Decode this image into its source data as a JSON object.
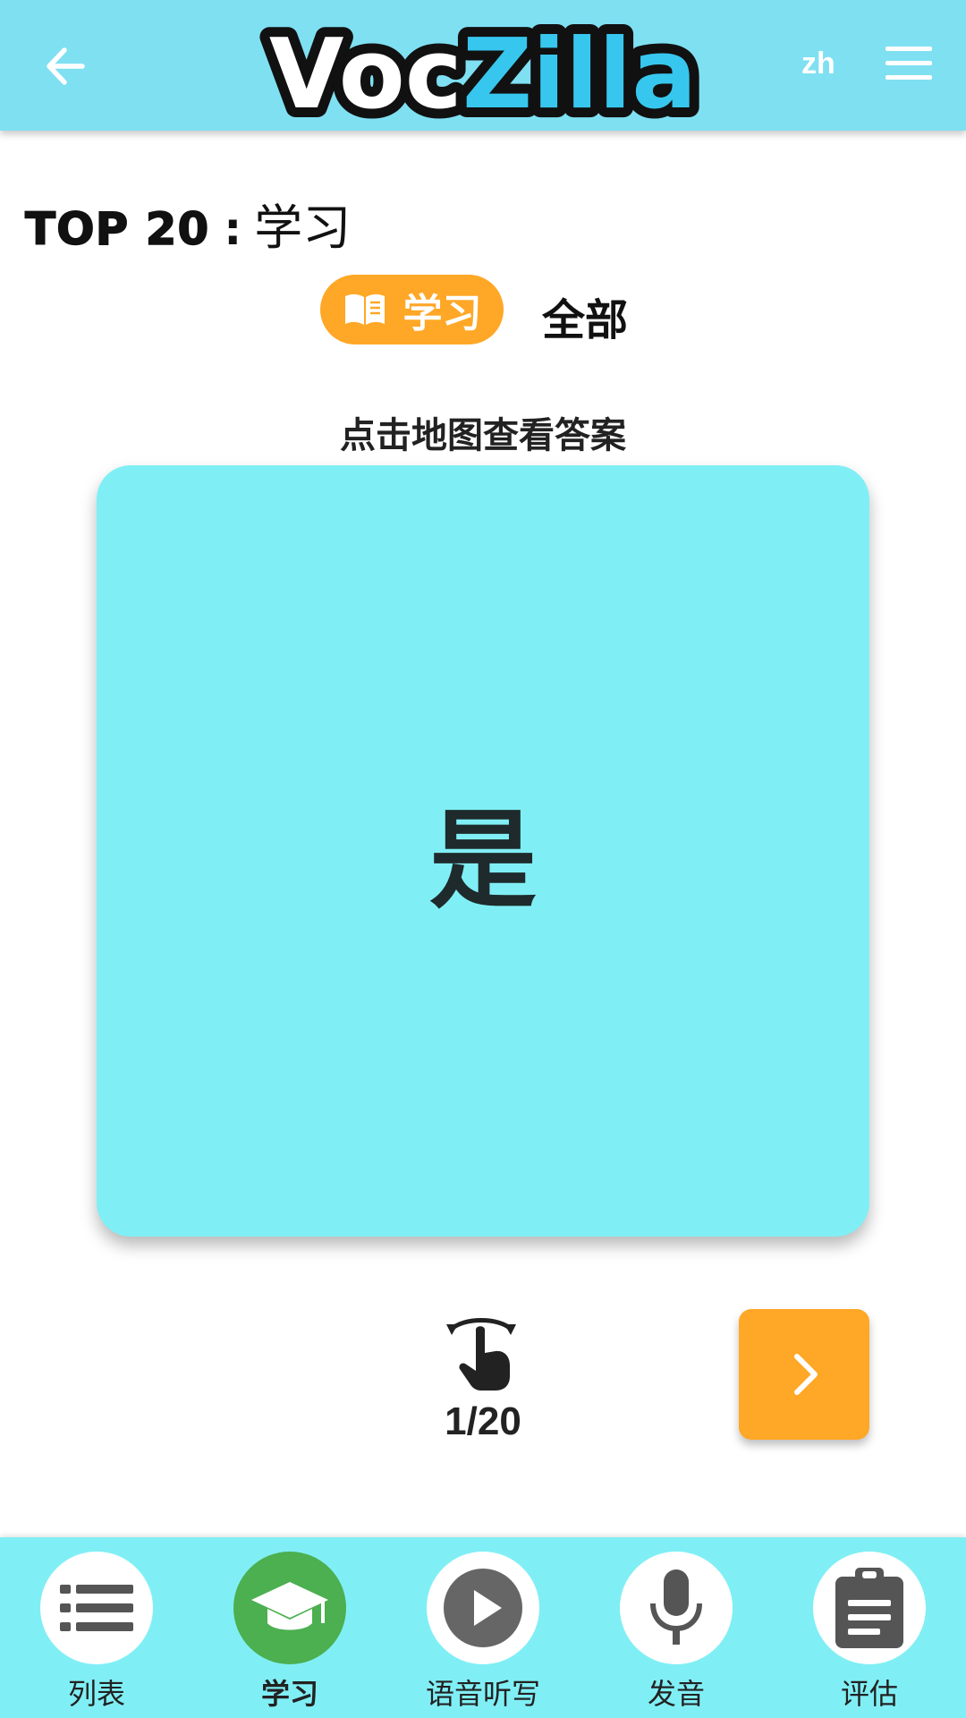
{
  "header": {
    "logo_part1": "Voc",
    "logo_part2": "Zilla",
    "language": "zh",
    "back_icon": "arrow-left-icon",
    "menu_icon": "hamburger-menu-icon"
  },
  "title": {
    "strong": "TOP 20",
    "separator": ":",
    "rest": "学习"
  },
  "mode": {
    "active_label": "学习",
    "active_icon": "open-book-icon",
    "other_label": "全部"
  },
  "hint": "点击地图查看答案",
  "card": {
    "word": "是"
  },
  "progress": {
    "counter": "1/20",
    "current": 1,
    "total": 20
  },
  "bottom_nav": [
    {
      "label": "列表",
      "icon": "list-icon",
      "active": false
    },
    {
      "label": "学习",
      "icon": "graduation-cap-icon",
      "active": true
    },
    {
      "label": "语音听写",
      "icon": "play-icon",
      "active": false
    },
    {
      "label": "发音",
      "icon": "microphone-icon",
      "active": false
    },
    {
      "label": "评估",
      "icon": "clipboard-icon",
      "active": false
    }
  ],
  "colors": {
    "header_bg": "#7fe0f2",
    "card_bg": "#80eff5",
    "accent_orange": "#ffa726",
    "active_green": "#4caf50",
    "logo_blue": "#37c7ee"
  }
}
